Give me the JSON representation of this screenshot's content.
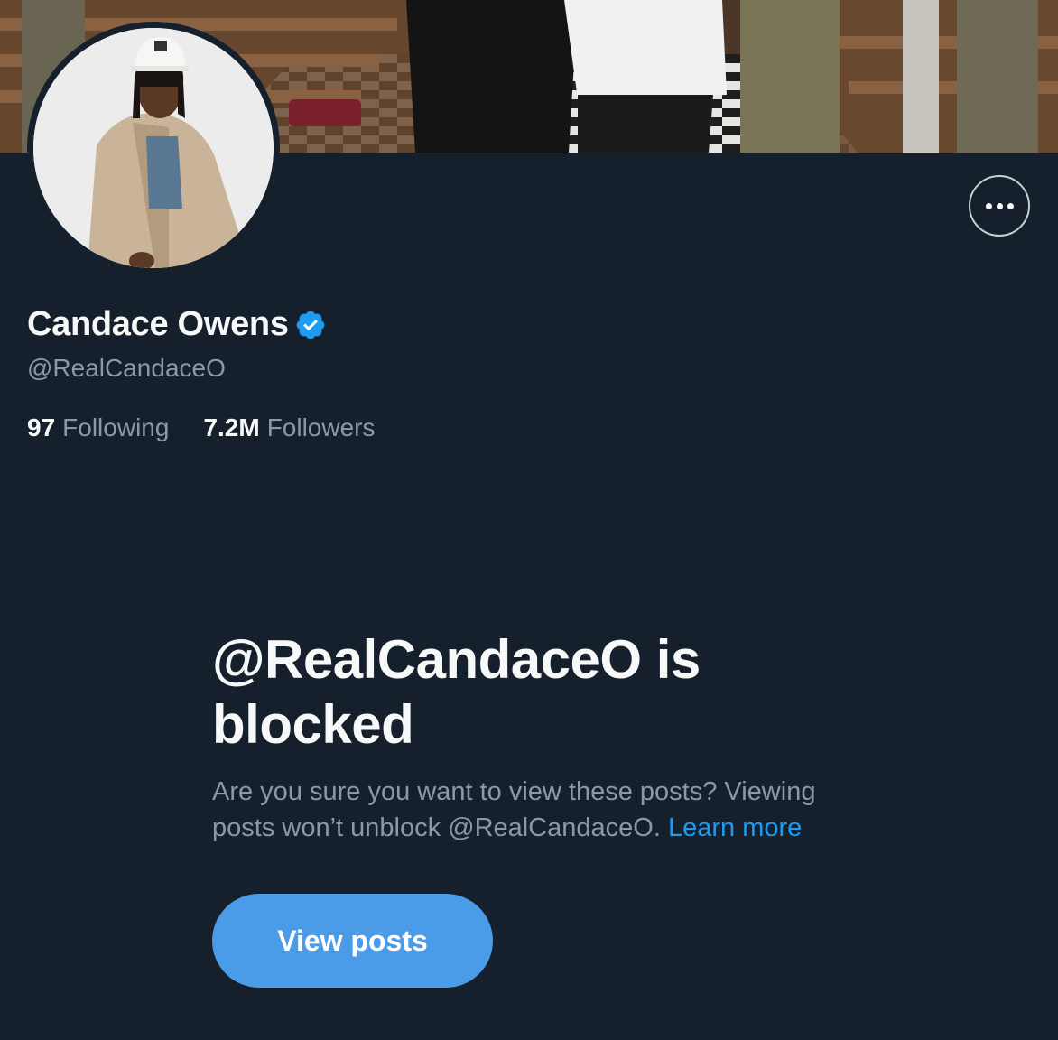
{
  "profile": {
    "display_name": "Candace Owens",
    "handle": "@RealCandaceO",
    "verified": true,
    "stats": [
      {
        "count": "97",
        "label": "Following"
      },
      {
        "count": "7.2M",
        "label": "Followers"
      }
    ]
  },
  "blocked_notice": {
    "title": "@RealCandaceO is blocked",
    "description": "Are you sure you want to view these posts? Viewing posts won’t unblock @RealCandaceO.",
    "learn_more": "Learn more",
    "view_posts_label": "View posts"
  },
  "icons": {
    "more": "more-horizontal-icon",
    "verified": "verified-badge-icon"
  },
  "colors": {
    "background": "#16202c",
    "accent": "#1d9bf0",
    "button": "#4a9be8",
    "secondary_text": "#8b98a5"
  }
}
